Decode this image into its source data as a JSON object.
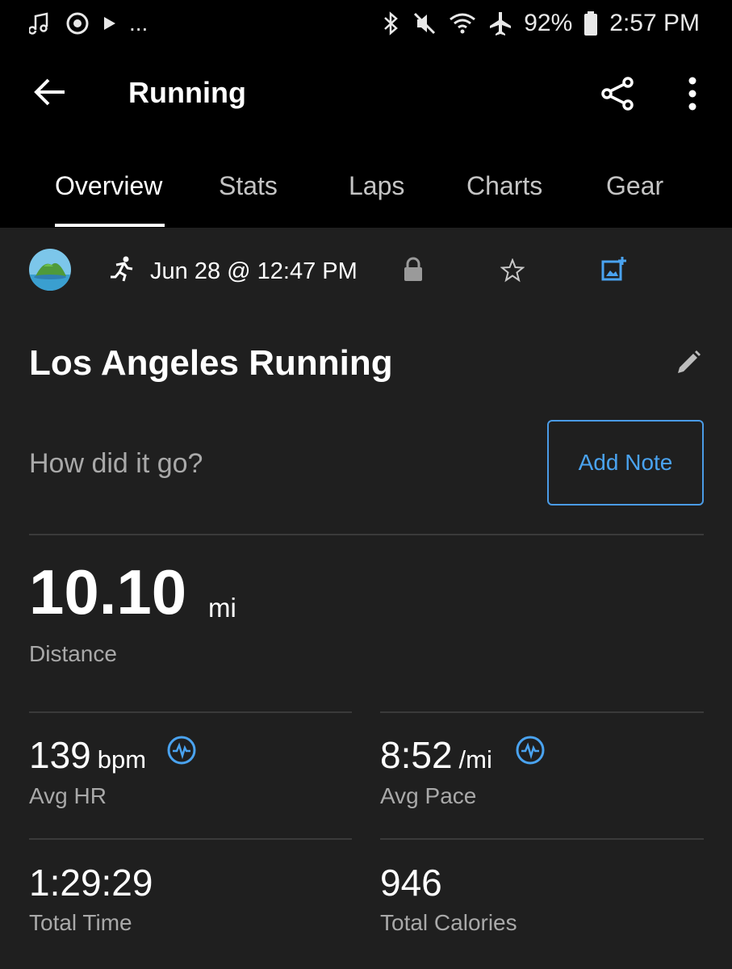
{
  "status_bar": {
    "battery": "92%",
    "time": "2:57 PM",
    "more": "..."
  },
  "app_bar": {
    "title": "Running"
  },
  "tabs": [
    {
      "label": "Overview",
      "active": true
    },
    {
      "label": "Stats",
      "active": false
    },
    {
      "label": "Laps",
      "active": false
    },
    {
      "label": "Charts",
      "active": false
    },
    {
      "label": "Gear",
      "active": false
    }
  ],
  "activity": {
    "date": "Jun 28 @ 12:47 PM",
    "title": "Los Angeles Running",
    "note_prompt": "How did it go?",
    "add_note_label": "Add Note"
  },
  "distance": {
    "value": "10.10",
    "unit": "mi",
    "label": "Distance"
  },
  "stats": {
    "avg_hr": {
      "value": "139",
      "unit": "bpm",
      "label": "Avg HR"
    },
    "avg_pace": {
      "value": "8:52",
      "unit": "/mi",
      "label": "Avg Pace"
    },
    "total_time": {
      "value": "1:29:29",
      "label": "Total Time"
    },
    "total_calories": {
      "value": "946",
      "label": "Total Calories"
    }
  },
  "colors": {
    "accent": "#4aa3f0",
    "background": "#1f1f1f",
    "header": "#000000",
    "secondary_text": "#a9a9a9"
  },
  "icons": [
    "music-icon",
    "sync-icon",
    "play-icon",
    "bluetooth-icon",
    "mute-icon",
    "wifi-icon",
    "airplane-icon",
    "battery-icon",
    "back-arrow-icon",
    "share-icon",
    "more-vert-icon",
    "avatar",
    "running-icon",
    "lock-icon",
    "star-icon",
    "add-photo-icon",
    "edit-icon",
    "heart-rate-icon"
  ]
}
